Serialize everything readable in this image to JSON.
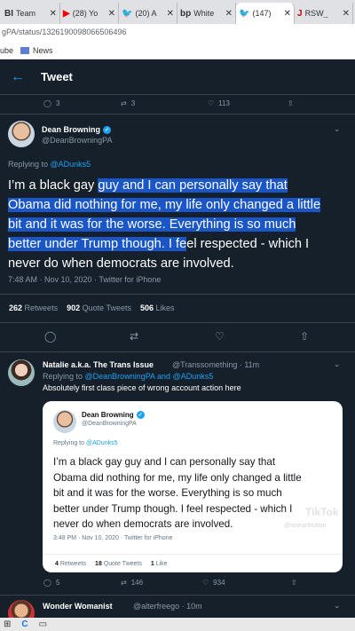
{
  "browser": {
    "tabs": [
      {
        "favicon": "BI",
        "title": "Team",
        "active": false
      },
      {
        "favicon": "▶",
        "title": "(28) Yo",
        "active": false
      },
      {
        "favicon": "🐦",
        "title": "(20) A",
        "active": false
      },
      {
        "favicon": "bp",
        "title": "White",
        "active": false
      },
      {
        "favicon": "🐦",
        "title": "(147)",
        "active": true
      },
      {
        "favicon": "J",
        "title": "RSW_",
        "active": false
      }
    ],
    "address": "gPA/status/1326190098066506496",
    "bookmarks": {
      "first": "ube",
      "news": "News"
    }
  },
  "header": {
    "title": "Tweet",
    "back_icon": "arrow-left-icon"
  },
  "prev_actions": {
    "reply": "3",
    "retweet": "3",
    "like": "113"
  },
  "main_tweet": {
    "name": "Dean Browning",
    "handle": "@DeanBrowningPA",
    "reply_to_prefix": "Replying to ",
    "reply_to_handle": "@ADunks5",
    "text_plain_1": "I’m a black gay ",
    "text_hl_1": "guy and I can personally say that",
    "text_hl_2": "Obama did nothing for me, my life only changed a little",
    "text_hl_3": "bit and it was for the worse. Everything is so much",
    "text_hl_4": "better under Trump though. I fe",
    "text_plain_2": "el respected - which I",
    "text_plain_3": "never do when democrats are involved.",
    "timestamp": "7:48 AM · Nov 10, 2020 · Twitter for iPhone",
    "retweets": "262",
    "retweets_label": "Retweets",
    "quotes": "902",
    "quotes_label": "Quote Tweets",
    "likes": "506",
    "likes_label": "Likes"
  },
  "reply_tweet": {
    "name": "Natalie a.k.a. The Trans Issue",
    "handle": "@Transsomething · 11m",
    "reply_to_prefix": "Replying to ",
    "reply_to_handles": "@DeanBrowningPA and @ADunks5",
    "text": "Absolutely first class piece of wrong account action here",
    "actions": {
      "reply": "5",
      "retweet": "146",
      "like": "934"
    }
  },
  "embedded_card": {
    "name": "Dean Browning",
    "handle": "@DeanBrowningPA",
    "reply_to_prefix": "Replying to ",
    "reply_to_handle": "@ADunks5",
    "text_lines": [
      "I’m a black gay guy and I can personally say that",
      "Obama did nothing for me, my life only changed a little",
      "bit and it was for the worse. Everything is so much",
      "better under Trump though. I feel respected - which I",
      "never do when democrats are involved."
    ],
    "timestamp": "3:48 PM · Nov 10, 2020 · Twitter for iPhone",
    "retweets": "4",
    "retweets_label": "Retweets",
    "quotes": "18",
    "quotes_label": "Quote Tweets",
    "likes": "1",
    "likes_label": "Like"
  },
  "watermark": {
    "brand": "TikTok",
    "user": "@iuseartbutton"
  },
  "next_tweet": {
    "name": "Wonder Womanist",
    "handle": "@alterfreego · 10m"
  },
  "colors": {
    "background": "#15202b",
    "accent": "#1da1f2",
    "highlight": "#1a56c8"
  }
}
